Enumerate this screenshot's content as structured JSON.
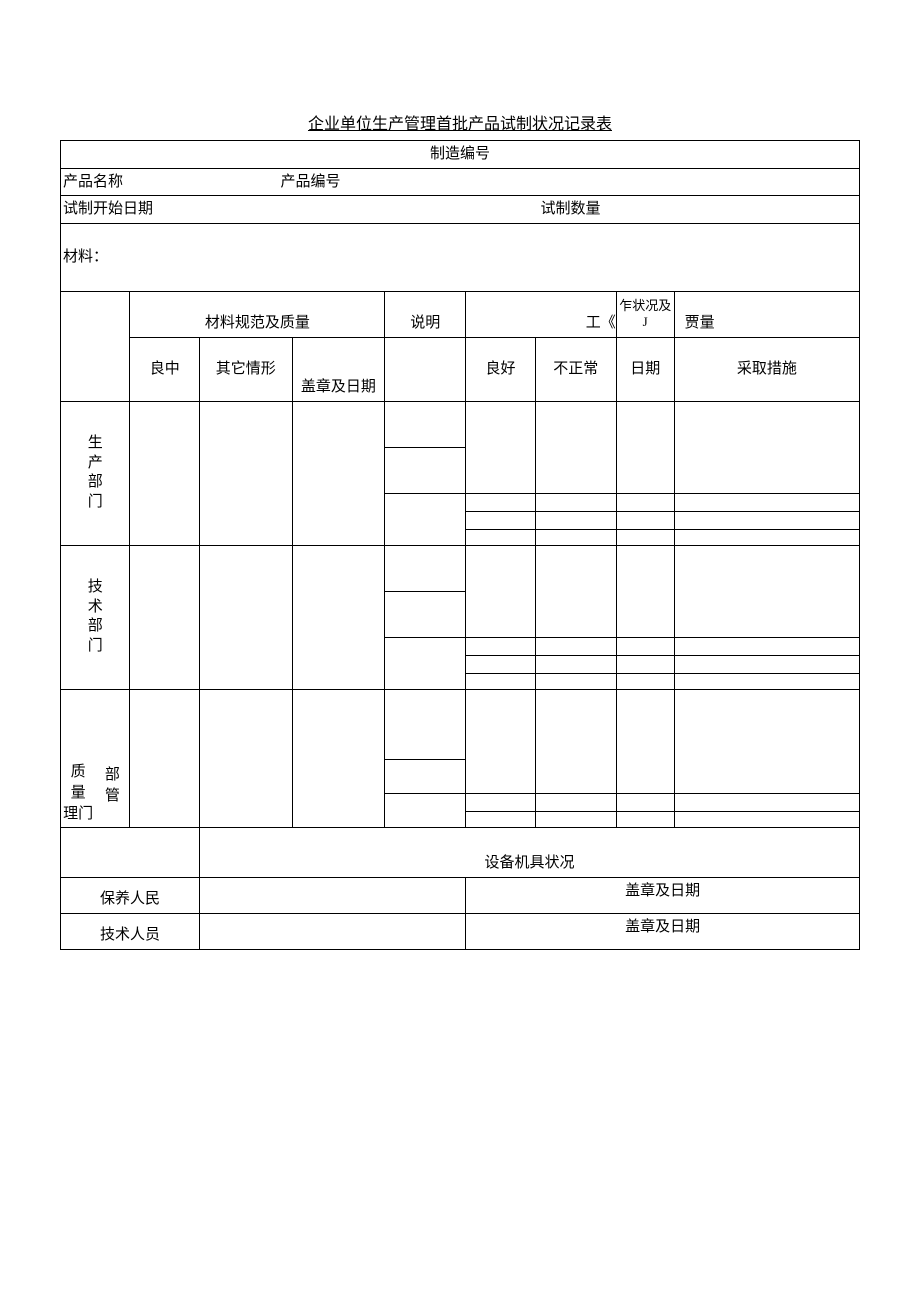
{
  "title": "企业单位生产管理首批产品试制状况记录表",
  "fields": {
    "mfg_no": "制造编号",
    "product_name": "产品名称",
    "product_no": "产品编号",
    "trial_start_date": "试制开始日期",
    "trial_qty": "试制数量",
    "material": "材料："
  },
  "headers": {
    "material_spec": "材料规范及质量",
    "desc": "说明",
    "work": "工《",
    "work_status": "乍状况及",
    "j": "J",
    "quality_frag": "贾量",
    "good_mid": "良中",
    "other_case": "其它情形",
    "seal_date": "盖章及日期",
    "good": "良好",
    "abnormal": "不正常",
    "date": "日期",
    "measures": "采取措施"
  },
  "rows": {
    "production": [
      "生",
      "产",
      "部",
      "门"
    ],
    "technical": [
      "技",
      "术",
      "部",
      "门"
    ],
    "qc": {
      "c1r1": "质",
      "c1r2": "量",
      "c1r3": "理门",
      "c2r1": "部",
      "c2r2": "管"
    },
    "equipment_status": "设备机具状况",
    "maintenance": "保养人民",
    "tech_person": "技术人员",
    "seal_date": "盖章及日期"
  }
}
